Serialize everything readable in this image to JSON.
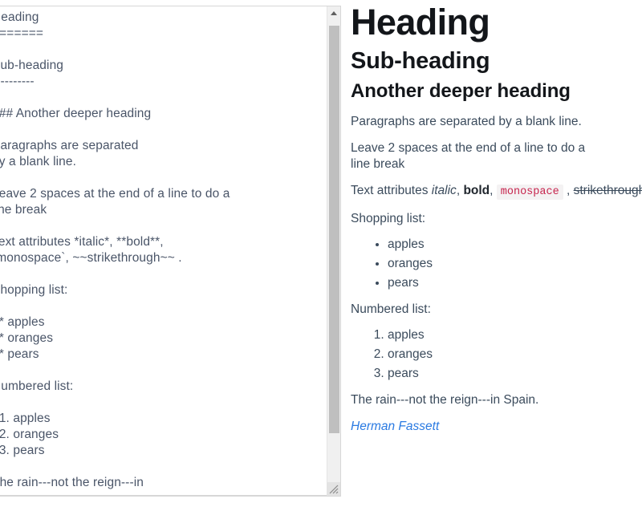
{
  "editor": {
    "name": "markdown-source-textarea",
    "source": "Heading\n=======\n\nSub-heading\n----------\n \n### Another deeper heading\n \nParagraphs are separated\nby a blank line.\n\nLeave 2 spaces at the end of a line to do a\nline break\n\nText attributes *italic*, **bold**,\n`monospace`, ~~strikethrough~~ .\n\nShopping list:\n\n  * apples\n  * oranges\n  * pears\n\nNumbered list:\n\n  1. apples\n  2. oranges\n  3. pears\n\nThe rain---not the reign---in",
    "scrollbar": {
      "up_arrow": "scroll-up-arrow",
      "down_arrow": "scroll-down-arrow",
      "thumb": "scroll-thumb"
    },
    "resize_grip": "resize-grip-icon"
  },
  "preview": {
    "h1": "Heading",
    "h2": "Sub-heading",
    "h3": "Another deeper heading",
    "p1": "Paragraphs are separated by a blank line.",
    "p2_line1": "Leave 2 spaces at the end of a line to do a",
    "p2_line2": "line break",
    "attrs": {
      "lead": "Text attributes ",
      "italic": "italic",
      "sep1": ", ",
      "bold": "bold",
      "sep2": ", ",
      "monospace": "monospace",
      "sep3": " , ",
      "strikethrough": "strikethrough",
      "trail": " ."
    },
    "shopping_label": "Shopping list:",
    "shopping_items": [
      "apples",
      "oranges",
      "pears"
    ],
    "numbered_label": "Numbered list:",
    "numbered_items": [
      "apples",
      "oranges",
      "pears"
    ],
    "rain": "The rain---not the reign---in Spain.",
    "author": "Herman Fassett"
  },
  "colors": {
    "heading": "#13161a",
    "body": "#3b4b5c",
    "editor_text": "#4a5568",
    "link": "#2a7ae2",
    "code_text": "#c7254e",
    "code_bg": "#f4f2f3",
    "scroll_track": "#f0f0f0",
    "scroll_thumb": "#bfbfbf",
    "border": "#d7d7d7"
  }
}
